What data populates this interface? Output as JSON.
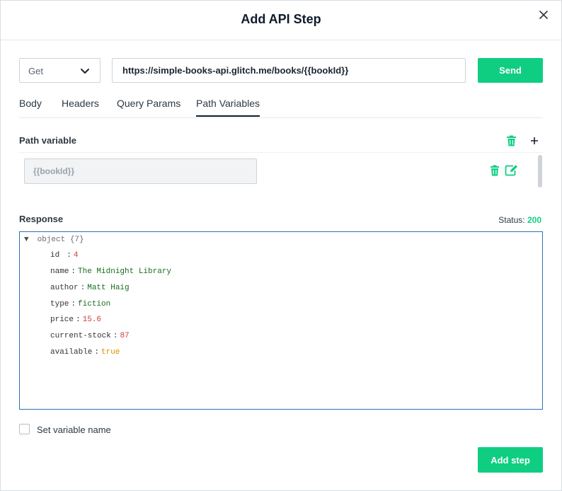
{
  "modal": {
    "title": "Add API Step",
    "close_icon": "close-icon"
  },
  "request": {
    "method": "Get",
    "url": "https://simple-books-api.glitch.me/books/{{bookId}}",
    "send_label": "Send"
  },
  "tabs": [
    {
      "label": "Body",
      "active": false
    },
    {
      "label": "Headers",
      "active": false
    },
    {
      "label": "Query Params",
      "active": false
    },
    {
      "label": "Path Variables",
      "active": true
    }
  ],
  "path_variable": {
    "label": "Path variable",
    "row_value": "{{bookId}}"
  },
  "response": {
    "label": "Response",
    "status_label": "Status:",
    "status_code": "200",
    "object_label": "object",
    "object_count": "{7}",
    "fields": [
      {
        "key": "id",
        "value": "4",
        "type": "number"
      },
      {
        "key": "name",
        "value": "The Midnight Library",
        "type": "string"
      },
      {
        "key": "author",
        "value": "Matt Haig",
        "type": "string"
      },
      {
        "key": "type",
        "value": "fiction",
        "type": "string"
      },
      {
        "key": "price",
        "value": "15.6",
        "type": "number"
      },
      {
        "key": "current-stock",
        "value": "87",
        "type": "number"
      },
      {
        "key": "available",
        "value": "true",
        "type": "boolean"
      }
    ]
  },
  "footer": {
    "set_variable_label": "Set variable name",
    "set_variable_checked": false,
    "add_step_label": "Add step"
  },
  "colors": {
    "accent_green": "#0fce82",
    "response_border": "#2a6fb5",
    "json_string": "#1a6d1a",
    "json_number": "#d33a3a",
    "json_boolean": "#e08a00"
  }
}
